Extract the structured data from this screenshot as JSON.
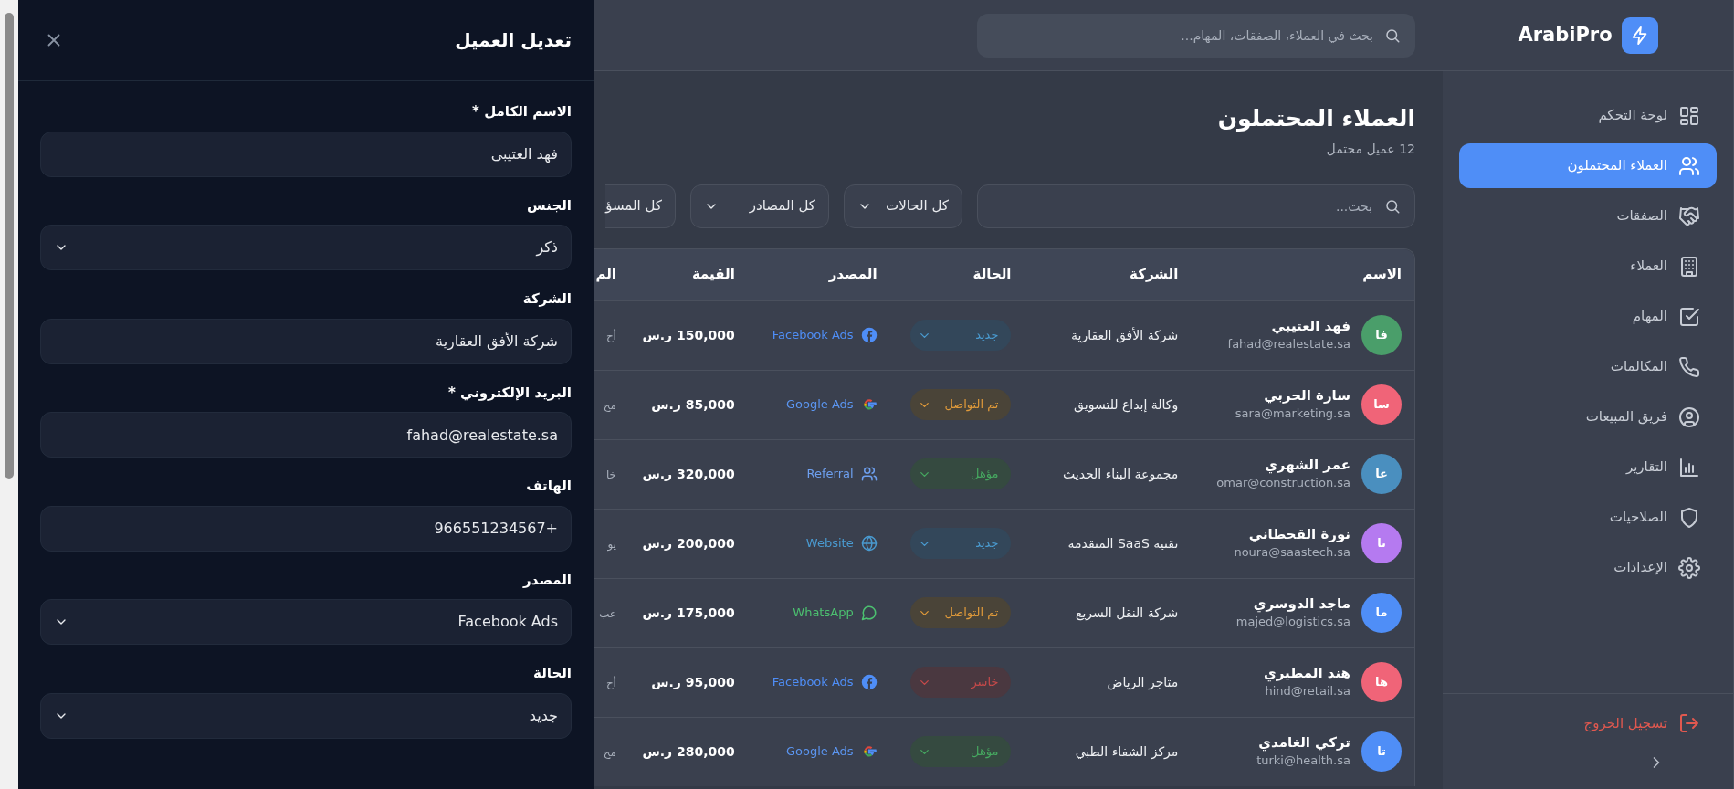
{
  "drawer": {
    "title": "تعديل العميل",
    "fields": [
      {
        "label": "الاسم الكامل *",
        "kind": "text",
        "value": "فهد العتيبى"
      },
      {
        "label": "الجنس",
        "kind": "select",
        "value": "ذكر"
      },
      {
        "label": "الشركة",
        "kind": "text",
        "value": "شركة الأفق العقارية"
      },
      {
        "label": "البريد الإلكتروني *",
        "kind": "text",
        "value": "fahad@realestate.sa"
      },
      {
        "label": "الهاتف",
        "kind": "text",
        "value": "+966551234567"
      },
      {
        "label": "المصدر",
        "kind": "select",
        "value": "Facebook Ads"
      },
      {
        "label": "الحالة",
        "kind": "select",
        "value": "جديد"
      }
    ]
  },
  "topbar": {
    "search_placeholder": "بحث في العملاء، الصفقات، المهام..."
  },
  "sidebar": {
    "logo": "ArabiPro",
    "items": [
      {
        "label": "لوحة التحكم",
        "kind": "dashboard",
        "selected": false
      },
      {
        "label": "العملاء المحتملون",
        "kind": "leads",
        "selected": true
      },
      {
        "label": "الصفقات",
        "kind": "deals",
        "selected": false
      },
      {
        "label": "العملاء",
        "kind": "clients",
        "selected": false
      },
      {
        "label": "المهام",
        "kind": "tasks",
        "selected": false
      },
      {
        "label": "المكالمات",
        "kind": "calls",
        "selected": false
      },
      {
        "label": "فريق المبيعات",
        "kind": "team",
        "selected": false
      },
      {
        "label": "التقارير",
        "kind": "reports",
        "selected": false
      },
      {
        "label": "الصلاحيات",
        "kind": "permissions",
        "selected": false
      },
      {
        "label": "الإعدادات",
        "kind": "settings",
        "selected": false
      }
    ],
    "logout": "تسجيل الخروج"
  },
  "page": {
    "title": "العملاء المحتملون",
    "subtitle": "12 عميل محتمل",
    "search_placeholder": "بحث...",
    "filters": [
      "كل الحالات",
      "كل المصادر",
      "كل المسؤ"
    ]
  },
  "table": {
    "columns": [
      "الاسم",
      "الشركة",
      "الحالة",
      "المصدر",
      "القيمة",
      "الم"
    ],
    "rows": [
      {
        "initials": "فا",
        "color": "#4a9e6a",
        "name": "فهد العتيبي",
        "email": "fahad@realestate.sa",
        "company": "شركة الأفق العقارية",
        "status": {
          "label": "جديد",
          "kind": "new"
        },
        "source": {
          "label": "Facebook Ads",
          "kind": "facebook"
        },
        "value": "150,000 ر.س",
        "column_6": "أح"
      },
      {
        "initials": "سا",
        "color": "#f06478",
        "name": "سارة الحربي",
        "email": "sara@marketing.sa",
        "company": "وكالة إبداع للتسويق",
        "status": {
          "label": "تم التواصل",
          "kind": "contacted"
        },
        "source": {
          "label": "Google Ads",
          "kind": "google"
        },
        "value": "85,000 ر.س",
        "column_6": "مح"
      },
      {
        "initials": "عا",
        "color": "#4a8fbf",
        "name": "عمر الشهري",
        "email": "omar@construction.sa",
        "company": "مجموعة البناء الحديث",
        "status": {
          "label": "مؤهل",
          "kind": "qualified"
        },
        "source": {
          "label": "Referral",
          "kind": "referral"
        },
        "value": "320,000 ر.س",
        "column_6": "خا"
      },
      {
        "initials": "نا",
        "color": "#b57af0",
        "name": "نورة القحطاني",
        "email": "noura@saastech.sa",
        "company": "تقنية SaaS المتقدمة",
        "status": {
          "label": "جديد",
          "kind": "new"
        },
        "source": {
          "label": "Website",
          "kind": "website"
        },
        "value": "200,000 ر.س",
        "column_6": "يو"
      },
      {
        "initials": "ما",
        "color": "#4f8ef7",
        "name": "ماجد الدوسري",
        "email": "majed@logistics.sa",
        "company": "شركة النقل السريع",
        "status": {
          "label": "تم التواصل",
          "kind": "contacted"
        },
        "source": {
          "label": "WhatsApp",
          "kind": "whatsapp"
        },
        "value": "175,000 ر.س",
        "column_6": "عب"
      },
      {
        "initials": "ها",
        "color": "#f06478",
        "name": "هند المطيري",
        "email": "hind@retail.sa",
        "company": "متاجر الرياض",
        "status": {
          "label": "خاسر",
          "kind": "lost"
        },
        "source": {
          "label": "Facebook Ads",
          "kind": "facebook"
        },
        "value": "95,000 ر.س",
        "column_6": "أح"
      },
      {
        "initials": "تا",
        "color": "#4f8ef7",
        "name": "تركي الغامدي",
        "email": "turki@health.sa",
        "company": "مركز الشفاء الطبي",
        "status": {
          "label": "مؤهل",
          "kind": "qualified"
        },
        "source": {
          "label": "Google Ads",
          "kind": "google"
        },
        "value": "280,000 ر.س",
        "column_6": "مح"
      }
    ]
  }
}
